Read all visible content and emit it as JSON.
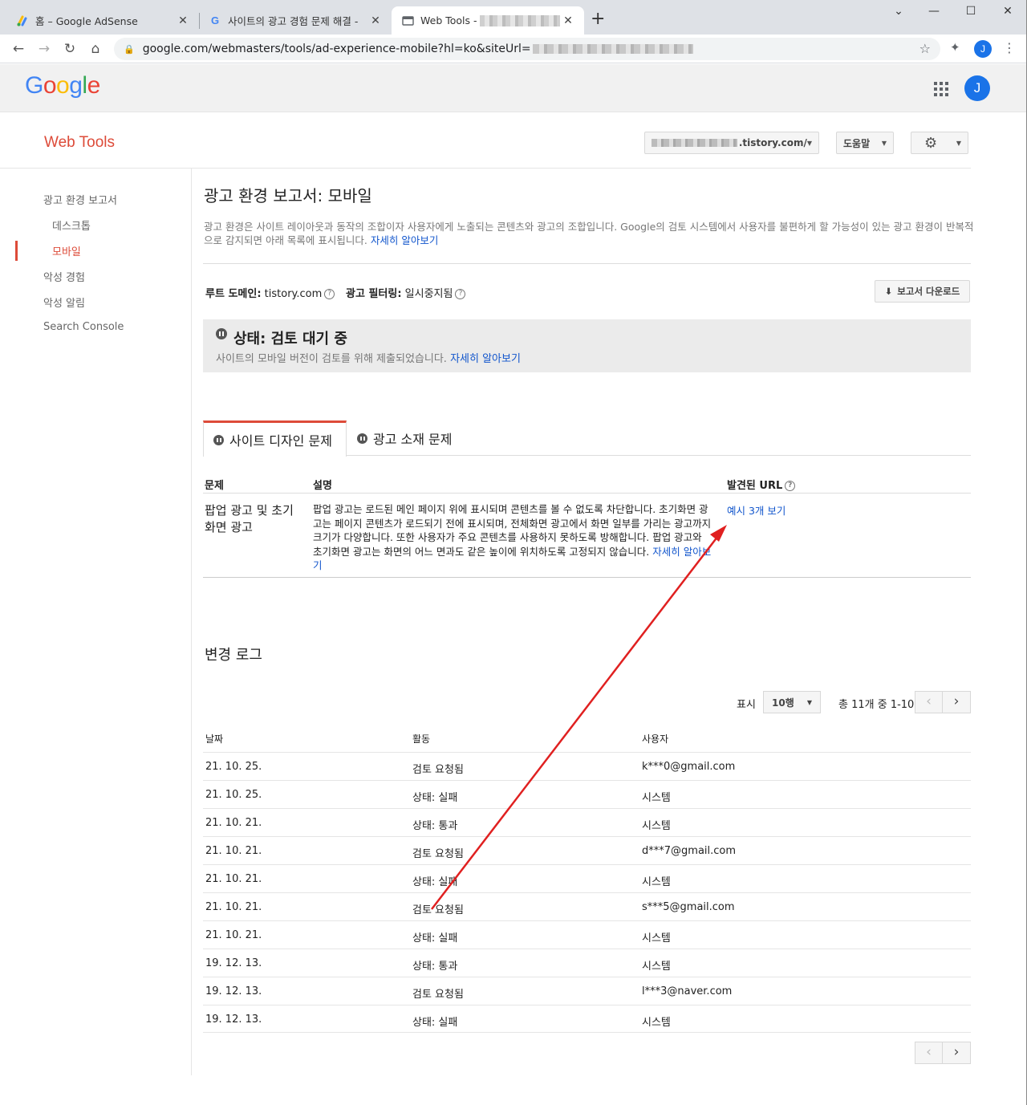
{
  "browser": {
    "tabs": [
      {
        "label": "홈 – Google AdSense",
        "icon": "adsense-icon"
      },
      {
        "label": "사이트의 광고 경험 문제 해결 -",
        "icon": "google-g-icon"
      },
      {
        "label": "Web Tools -",
        "icon": "webtools-icon"
      }
    ],
    "url": "google.com/webmasters/tools/ad-experience-mobile?hl=ko&siteUrl=",
    "profile_initial": "J"
  },
  "header": {
    "logo_letters": [
      "G",
      "o",
      "o",
      "g",
      "l",
      "e"
    ],
    "avatar_initial": "J"
  },
  "webtools": {
    "title": "Web Tools",
    "site_selector": ".tistory.com/",
    "help_label": "도움말"
  },
  "sidebar": {
    "items": [
      {
        "label": "광고 환경 보고서"
      },
      {
        "label": "데스크톱"
      },
      {
        "label": "모바일"
      },
      {
        "label": "악성 경험"
      },
      {
        "label": "악성 알림"
      },
      {
        "label": "Search Console"
      }
    ]
  },
  "main": {
    "title": "광고 환경 보고서: 모바일",
    "description": "광고 환경은 사이트 레이아웃과 동작의 조합이자 사용자에게 노출되는 콘텐츠와 광고의 조합입니다. Google의 검토 시스템에서 사용자를 불편하게 할 가능성이 있는 광고 환경이 반복적으로 감지되면 아래 목록에 표시됩니다.",
    "learn_more": "자세히 알아보기",
    "root_domain_label": "루트 도메인:",
    "root_domain_value": "tistory.com",
    "ad_filtering_label": "광고 필터링:",
    "ad_filtering_value": "일시중지됨",
    "download_label": "보고서 다운로드",
    "status_title": "상태: 검토 대기 중",
    "status_sub": "사이트의 모바일 버전이 검토를 위해 제출되었습니다.",
    "tabs": [
      {
        "label": "사이트 디자인 문제"
      },
      {
        "label": "광고 소재 문제"
      }
    ],
    "issue_table": {
      "headers": {
        "issue": "문제",
        "desc": "설명",
        "urls": "발견된 URL"
      },
      "row": {
        "issue": "팝업 광고 및 초기화면 광고",
        "desc": "팝업 광고는 로드된 메인 페이지 위에 표시되며 콘텐츠를 볼 수 없도록 차단합니다. 초기화면 광고는 페이지 콘텐츠가 로드되기 전에 표시되며, 전체화면 광고에서 화면 일부를 가리는 광고까지 크기가 다양합니다. 또한 사용자가 주요 콘텐츠를 사용하지 못하도록 방해합니다. 팝업 광고와 초기화면 광고는 화면의 어느 면과도 같은 높이에 위치하도록 고정되지 않습니다.",
        "urls_link": "예시 3개 보기"
      }
    }
  },
  "changelog": {
    "title": "변경 로그",
    "show_label": "표시",
    "rows_option": "10행",
    "count_label": "총 11개 중 1-10",
    "headers": {
      "date": "날짜",
      "activity": "활동",
      "user": "사용자"
    },
    "rows": [
      {
        "date": "21. 10. 25.",
        "activity": "검토 요청됨",
        "user": "k***0@gmail.com"
      },
      {
        "date": "21. 10. 25.",
        "activity": "상태: 실패",
        "user": "시스템"
      },
      {
        "date": "21. 10. 21.",
        "activity": "상태: 통과",
        "user": "시스템"
      },
      {
        "date": "21. 10. 21.",
        "activity": "검토 요청됨",
        "user": "d***7@gmail.com"
      },
      {
        "date": "21. 10. 21.",
        "activity": "상태: 실패",
        "user": "시스템"
      },
      {
        "date": "21. 10. 21.",
        "activity": "검토 요청됨",
        "user": "s***5@gmail.com"
      },
      {
        "date": "21. 10. 21.",
        "activity": "상태: 실패",
        "user": "시스템"
      },
      {
        "date": "19. 12. 13.",
        "activity": "상태: 통과",
        "user": "시스템"
      },
      {
        "date": "19. 12. 13.",
        "activity": "검토 요청됨",
        "user": "l***3@naver.com"
      },
      {
        "date": "19. 12. 13.",
        "activity": "상태: 실패",
        "user": "시스템"
      }
    ]
  },
  "colors": {
    "accent_red": "#dd4b39",
    "link_blue": "#1155cc",
    "annotation_arrow": "#e02020"
  }
}
